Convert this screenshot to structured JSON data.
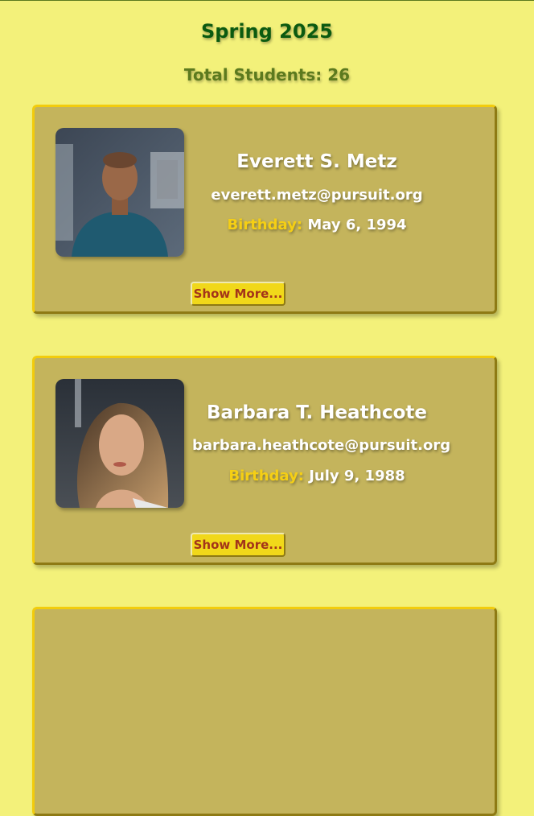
{
  "cohort": {
    "title": "Spring 2025",
    "total_text": "Total Students: 26"
  },
  "students": [
    {
      "name": "Everett S. Metz",
      "email": "everett.metz@pursuit.org",
      "birthday_label": "Birthday:",
      "birthday": "May 6, 1994",
      "button_label": "Show More..."
    },
    {
      "name": "Barbara T. Heathcote",
      "email": "barbara.heathcote@pursuit.org",
      "birthday_label": "Birthday:",
      "birthday": "July 9, 1988",
      "button_label": "Show More..."
    }
  ],
  "colors": {
    "background": "#f3f17a",
    "card": "#c4b45c",
    "card_border": "#f2cc0c",
    "title": "#0b5a10",
    "accent": "#f5cf14",
    "button_text": "#a3341a"
  }
}
